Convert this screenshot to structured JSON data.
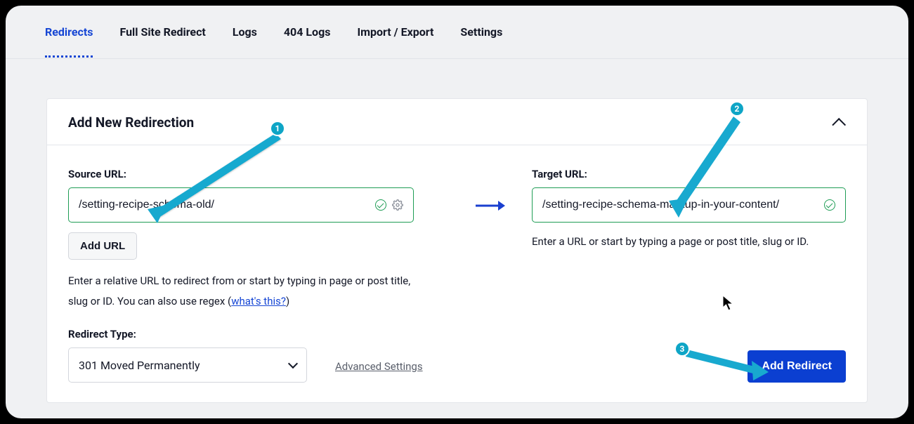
{
  "tabs": {
    "redirects": "Redirects",
    "full_site": "Full Site Redirect",
    "logs": "Logs",
    "logs404": "404 Logs",
    "import_export": "Import / Export",
    "settings": "Settings"
  },
  "card": {
    "title": "Add New Redirection"
  },
  "source": {
    "label": "Source URL:",
    "value": "/setting-recipe-schema-old/",
    "add_url_btn": "Add URL",
    "help_pre": "Enter a relative URL to redirect from or start by typing in page or post title, slug or ID. You can also use regex (",
    "help_link": "what's this?",
    "help_post": ")"
  },
  "target": {
    "label": "Target URL:",
    "value": "/setting-recipe-schema-markup-in-your-content/",
    "help": "Enter a URL or start by typing a page or post title, slug or ID."
  },
  "redirect_type": {
    "label": "Redirect Type:",
    "value": "301 Moved Permanently"
  },
  "advanced_link": "Advanced Settings",
  "add_redirect_btn": "Add Redirect",
  "annotations": {
    "b1": "1",
    "b2": "2",
    "b3": "3"
  }
}
